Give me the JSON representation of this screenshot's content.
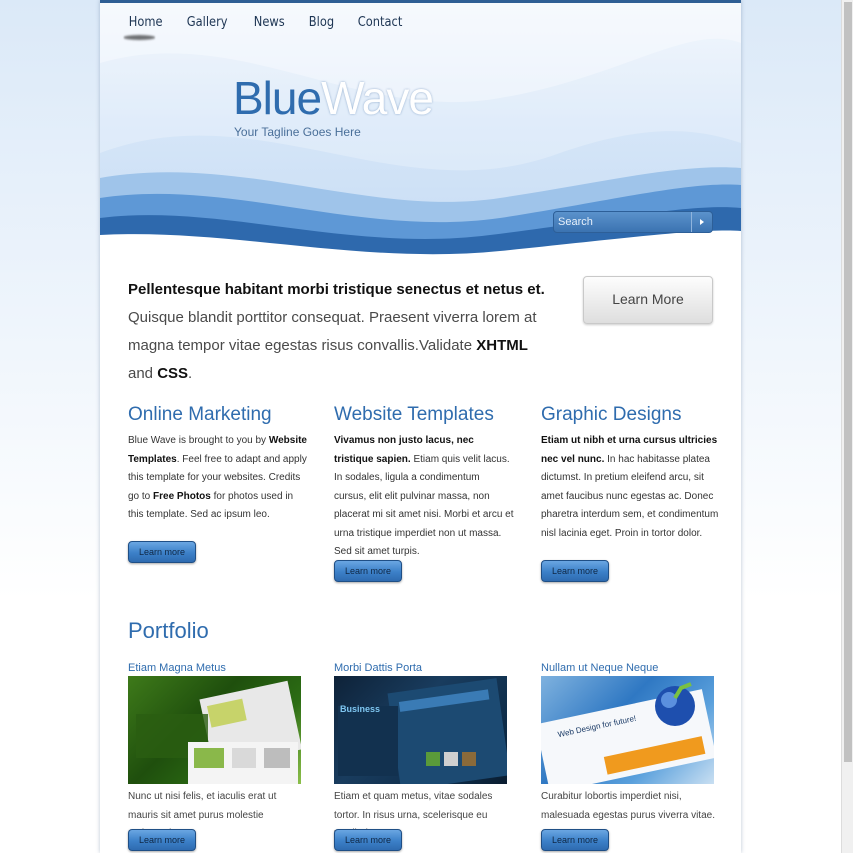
{
  "nav": {
    "items": [
      "Home",
      "Gallery",
      "News",
      "Blog",
      "Contact"
    ]
  },
  "logo": {
    "part1": "Blue",
    "part2": "Wave",
    "tagline": "Your Tagline Goes Here"
  },
  "search": {
    "placeholder": "Search",
    "go_icon": "triangle-right-icon"
  },
  "intro": {
    "lead": "Pellentesque habitant morbi tristique senectus et netus et.",
    "sub_text": "Quisque blandit porttitor consequat. Praesent viverra lorem at magna tempor vitae egestas risus convallis.Validate ",
    "xhtml": "XHTML",
    "and": " and ",
    "css": "CSS",
    "period": ".",
    "button": "Learn More"
  },
  "columns": [
    {
      "title": "Online Marketing",
      "t1": "Blue Wave is brought to you by ",
      "b1": "Website Templates",
      "t2": ". Feel free to adapt and apply this template for your websites. Credits go to ",
      "b2": "Free Photos",
      "t3": " for photos used in this template. Sed ac ipsum leo.",
      "button": "Learn more"
    },
    {
      "title": "Website Templates",
      "b1": "Vivamus non justo lacus, nec tristique sapien.",
      "t1": " Etiam quis velit lacus. In sodales, ligula a condimentum cursus, elit elit pulvinar massa, non placerat mi sit amet nisi. Morbi et arcu et urna tristique imperdiet non ut massa. Sed sit amet turpis.",
      "button": "Learn more"
    },
    {
      "title": "Graphic Designs",
      "b1": "Etiam ut nibh et urna cursus ultricies nec vel nunc.",
      "t1": " In hac habitasse platea dictumst. In pretium eleifend arcu, sit amet faucibus nunc egestas ac. Donec pharetra interdum sem, et condimentum nisl lacinia eget. Proin in tortor dolor.",
      "button": "Learn more"
    }
  ],
  "portfolio": {
    "title": "Portfolio",
    "items": [
      {
        "title": "Etiam Magna Metus",
        "text": "Nunc ut nisi felis, et iaculis erat ut mauris sit amet purus molestie malesuada.",
        "button": "Learn more"
      },
      {
        "title": "Morbi Dattis Porta",
        "text": "Etiam et quam metus, vitae sodales tortor. In risus urna, scelerisque eu vestibulums.",
        "button": "Learn more",
        "thumb_label": "Business"
      },
      {
        "title": "Nullam ut Neque Neque",
        "text": "Curabitur lobortis imperdiet nisi, malesuada egestas purus viverra vitae.",
        "button": "Learn more",
        "thumb_label": "Web Design for future!"
      }
    ]
  },
  "colors": {
    "accent": "#2f6cae",
    "button": "#3c80c8"
  }
}
